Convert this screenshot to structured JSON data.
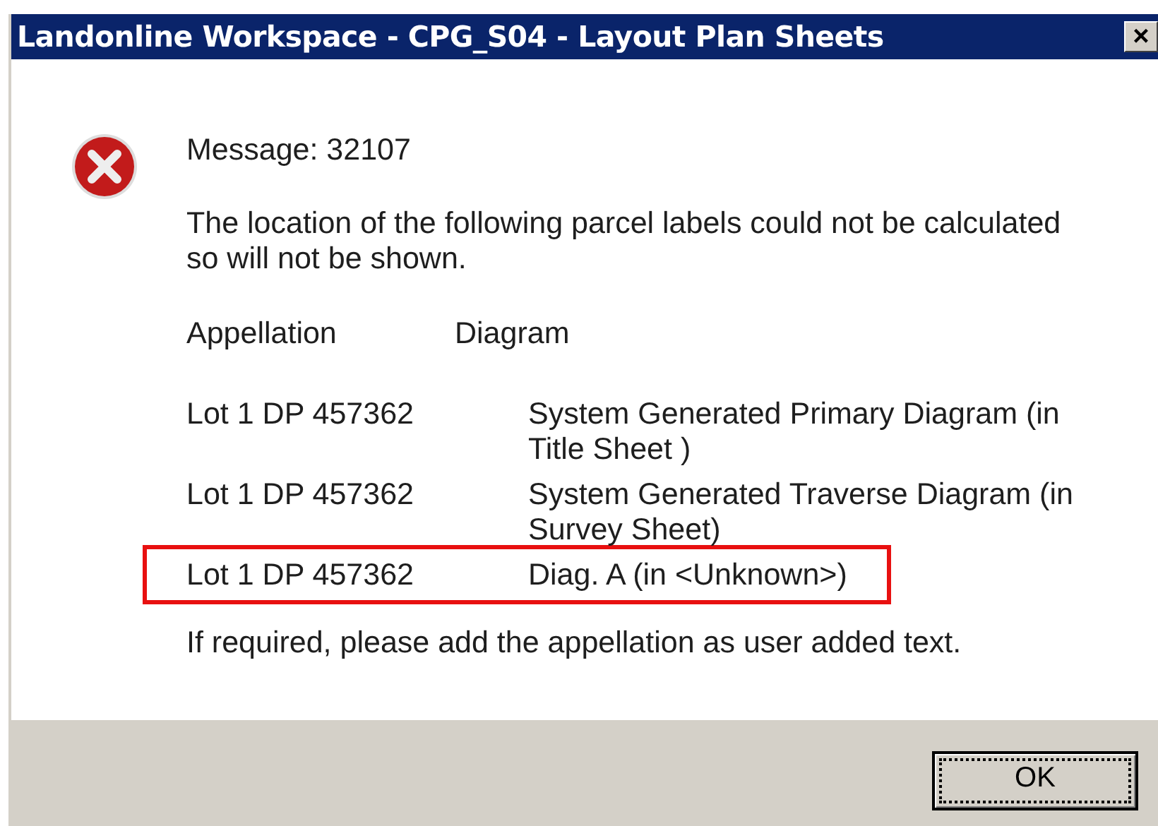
{
  "window": {
    "title": "Landonline Workspace - CPG_S04 - Layout Plan Sheets",
    "close_label": "×"
  },
  "message": {
    "code_line": "Message: 32107",
    "text": "The location of the following parcel labels could not be calculated so will not be shown.",
    "columns": [
      "Appellation",
      "Diagram"
    ],
    "rows": [
      {
        "appellation": "Lot 1 DP 457362",
        "diagram": "System Generated Primary Diagram (in Title Sheet )",
        "highlighted": false
      },
      {
        "appellation": "Lot 1 DP 457362",
        "diagram": "System Generated Traverse Diagram (in Survey Sheet)",
        "highlighted": false
      },
      {
        "appellation": "Lot 1 DP 457362",
        "diagram": "Diag. A (in <Unknown>)",
        "highlighted": true
      }
    ],
    "footer_text": "If required, please add the appellation as user added text."
  },
  "buttons": [
    {
      "label": "OK",
      "focused": true
    }
  ]
}
